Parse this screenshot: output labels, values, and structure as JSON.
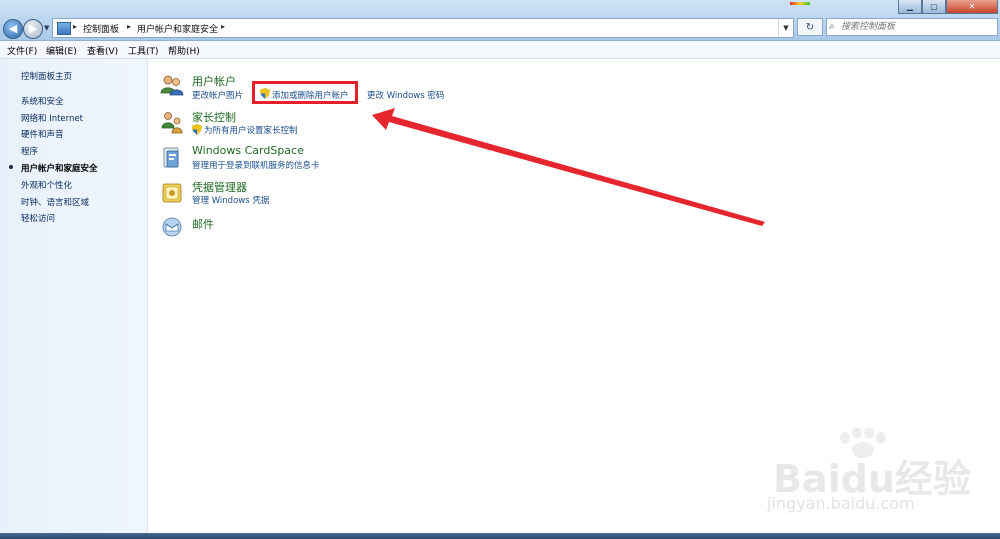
{
  "address": {
    "crumbs": [
      "控制面板",
      "用户帐户和家庭安全"
    ],
    "separators": [
      "▸",
      "▸",
      "▸"
    ]
  },
  "search": {
    "placeholder": "搜索控制面板"
  },
  "menu": [
    "文件(F)",
    "编辑(E)",
    "查看(V)",
    "工具(T)",
    "帮助(H)"
  ],
  "sidebar": {
    "items": [
      {
        "label": "控制面板主页",
        "current": false
      },
      {
        "label": "系统和安全",
        "current": false
      },
      {
        "label": "网络和 Internet",
        "current": false
      },
      {
        "label": "硬件和声音",
        "current": false
      },
      {
        "label": "程序",
        "current": false
      },
      {
        "label": "用户帐户和家庭安全",
        "current": true
      },
      {
        "label": "外观和个性化",
        "current": false
      },
      {
        "label": "时钟、语言和区域",
        "current": false
      },
      {
        "label": "轻松访问",
        "current": false
      }
    ]
  },
  "categories": [
    {
      "title": "用户帐户",
      "icon": "user-accounts-icon",
      "links": [
        "更改帐户图片",
        "添加或删除用户帐户",
        "更改 Windows 密码"
      ]
    },
    {
      "title": "家长控制",
      "icon": "parental-controls-icon",
      "links": [
        "为所有用户设置家长控制"
      ]
    },
    {
      "title": "Windows CardSpace",
      "icon": "cardspace-icon",
      "links": [
        "管理用于登录到联机服务的信息卡"
      ]
    },
    {
      "title": "凭据管理器",
      "icon": "credential-manager-icon",
      "links": [
        "管理 Windows 凭据"
      ]
    },
    {
      "title": "邮件",
      "icon": "mail-icon",
      "links": []
    }
  ],
  "watermark": {
    "brand": "Bai",
    "brand2": "du",
    "cn": "经验",
    "url": "jingyan.baidu.com"
  },
  "colors": {
    "highlight": "#e5202a",
    "link": "#1b4f8f",
    "title": "#1e6a22"
  }
}
